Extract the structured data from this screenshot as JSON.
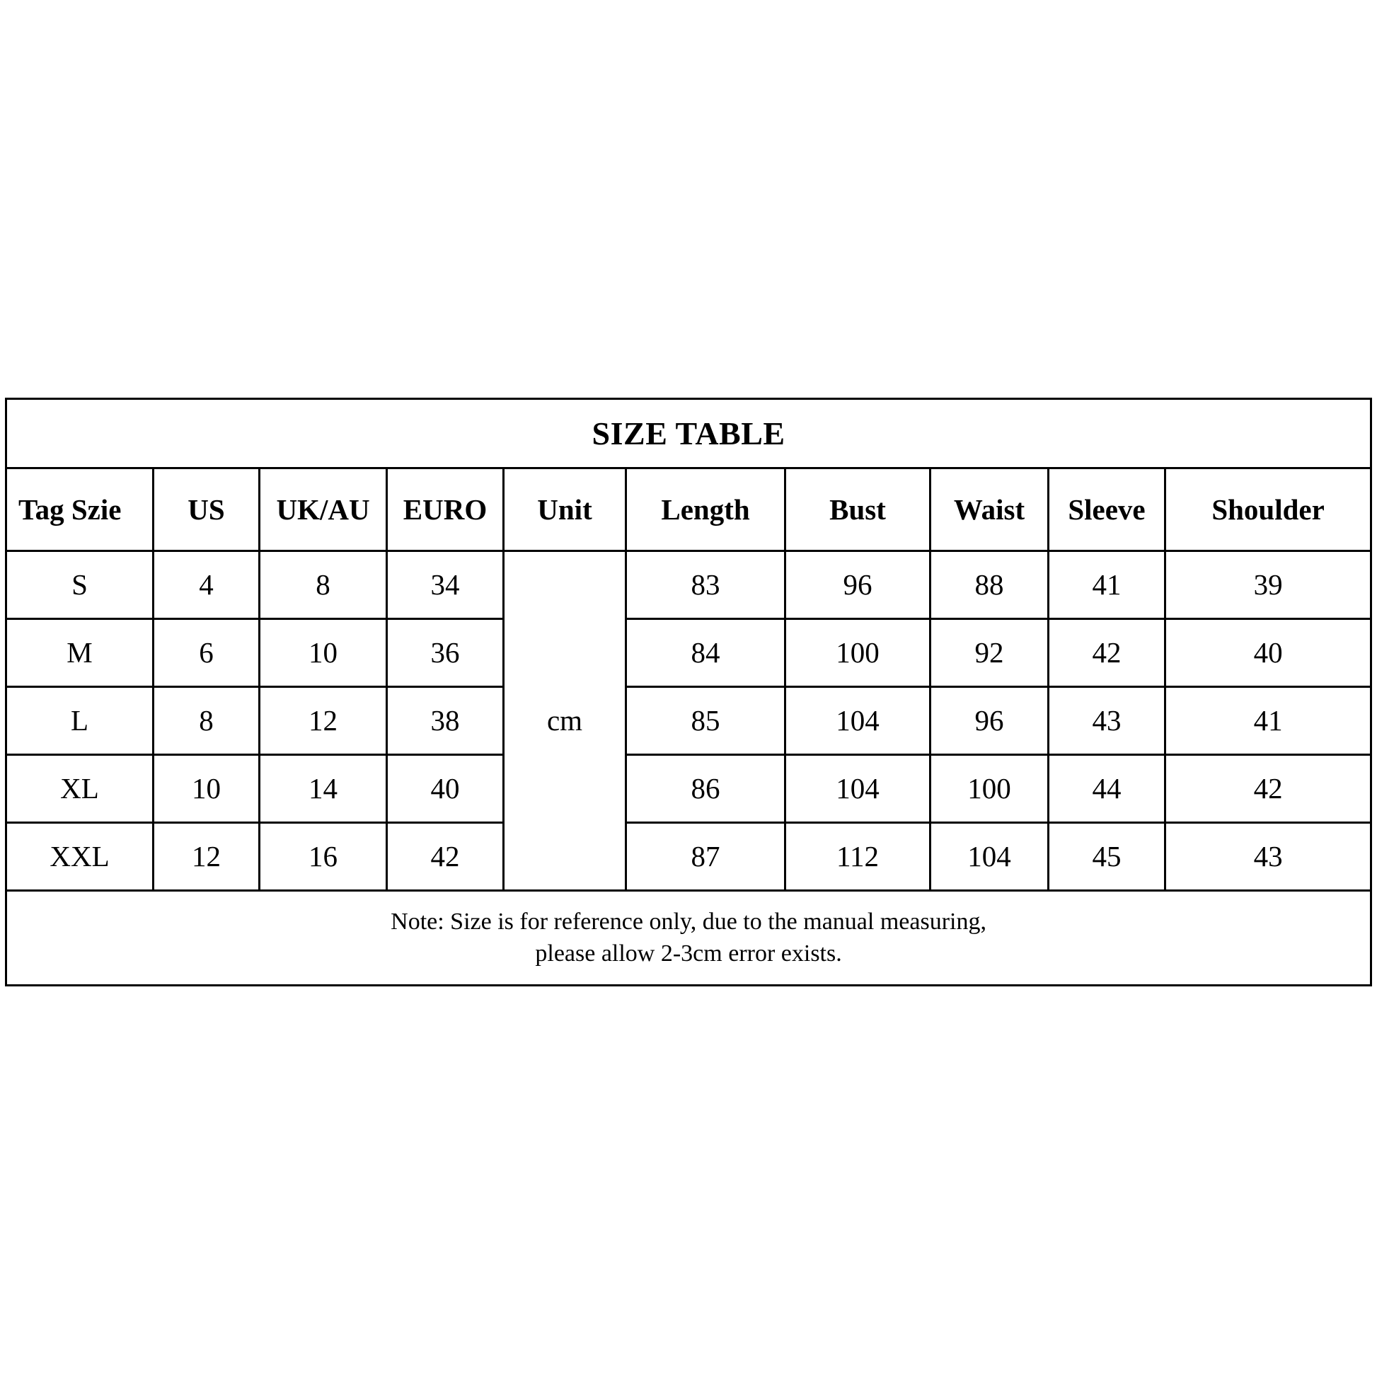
{
  "title": "SIZE TABLE",
  "table": {
    "columns": [
      {
        "key": "tag",
        "label": "Tag Szie"
      },
      {
        "key": "us",
        "label": "US"
      },
      {
        "key": "ukau",
        "label": "UK/AU"
      },
      {
        "key": "euro",
        "label": "EURO"
      },
      {
        "key": "unit",
        "label": "Unit"
      },
      {
        "key": "length",
        "label": "Length"
      },
      {
        "key": "bust",
        "label": "Bust"
      },
      {
        "key": "waist",
        "label": "Waist"
      },
      {
        "key": "sleeve",
        "label": "Sleeve"
      },
      {
        "key": "shoulder",
        "label": "Shoulder"
      }
    ],
    "unit_value": "cm",
    "rows": [
      {
        "tag": "S",
        "us": "4",
        "ukau": "8",
        "euro": "34",
        "length": "83",
        "bust": "96",
        "waist": "88",
        "sleeve": "41",
        "shoulder": "39"
      },
      {
        "tag": "M",
        "us": "6",
        "ukau": "10",
        "euro": "36",
        "length": "84",
        "bust": "100",
        "waist": "92",
        "sleeve": "42",
        "shoulder": "40"
      },
      {
        "tag": "L",
        "us": "8",
        "ukau": "12",
        "euro": "38",
        "length": "85",
        "bust": "104",
        "waist": "96",
        "sleeve": "43",
        "shoulder": "41"
      },
      {
        "tag": "XL",
        "us": "10",
        "ukau": "14",
        "euro": "40",
        "length": "86",
        "bust": "104",
        "waist": "100",
        "sleeve": "44",
        "shoulder": "42"
      },
      {
        "tag": "XXL",
        "us": "12",
        "ukau": "16",
        "euro": "42",
        "length": "87",
        "bust": "112",
        "waist": "104",
        "sleeve": "45",
        "shoulder": "43"
      }
    ],
    "note": {
      "line1": "Note: Size is for reference only, due to the manual measuring,",
      "line2": "please allow 2-3cm error exists."
    }
  },
  "chart_data": {
    "type": "table",
    "title": "SIZE TABLE",
    "columns": [
      "Tag Szie",
      "US",
      "UK/AU",
      "EURO",
      "Unit",
      "Length",
      "Bust",
      "Waist",
      "Sleeve",
      "Shoulder"
    ],
    "unit": "cm",
    "rows": [
      [
        "S",
        4,
        8,
        34,
        "cm",
        83,
        96,
        88,
        41,
        39
      ],
      [
        "M",
        6,
        10,
        36,
        "cm",
        84,
        100,
        92,
        42,
        40
      ],
      [
        "L",
        8,
        12,
        38,
        "cm",
        85,
        104,
        96,
        43,
        41
      ],
      [
        "XL",
        10,
        14,
        40,
        "cm",
        86,
        104,
        100,
        44,
        42
      ],
      [
        "XXL",
        12,
        16,
        42,
        "cm",
        87,
        112,
        104,
        45,
        43
      ]
    ],
    "annotations": [
      "Note: Size is for reference only, due to the manual measuring,",
      "please allow 2-3cm error exists."
    ]
  },
  "colors": {
    "background": "#ffffff",
    "border": "#000000",
    "text": "#000000"
  }
}
